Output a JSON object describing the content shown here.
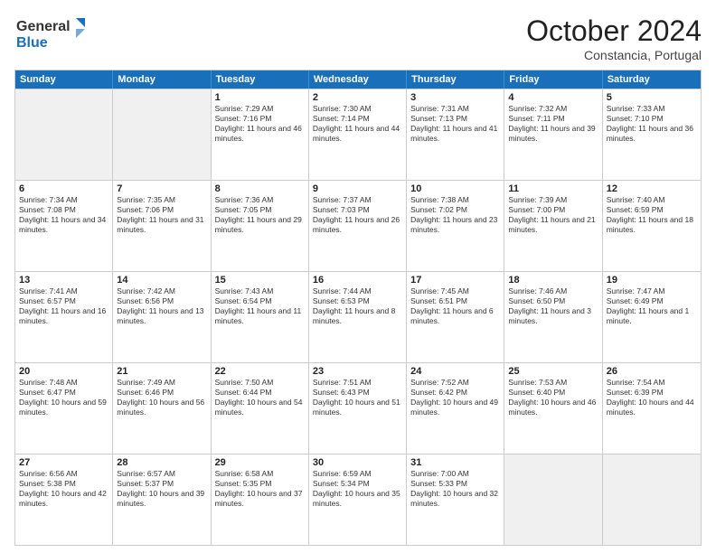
{
  "header": {
    "logo_line1": "General",
    "logo_line2": "Blue",
    "month": "October 2024",
    "location": "Constancia, Portugal"
  },
  "weekdays": [
    "Sunday",
    "Monday",
    "Tuesday",
    "Wednesday",
    "Thursday",
    "Friday",
    "Saturday"
  ],
  "rows": [
    [
      {
        "day": "",
        "lines": []
      },
      {
        "day": "",
        "lines": []
      },
      {
        "day": "1",
        "lines": [
          "Sunrise: 7:29 AM",
          "Sunset: 7:16 PM",
          "Daylight: 11 hours and 46 minutes."
        ]
      },
      {
        "day": "2",
        "lines": [
          "Sunrise: 7:30 AM",
          "Sunset: 7:14 PM",
          "Daylight: 11 hours and 44 minutes."
        ]
      },
      {
        "day": "3",
        "lines": [
          "Sunrise: 7:31 AM",
          "Sunset: 7:13 PM",
          "Daylight: 11 hours and 41 minutes."
        ]
      },
      {
        "day": "4",
        "lines": [
          "Sunrise: 7:32 AM",
          "Sunset: 7:11 PM",
          "Daylight: 11 hours and 39 minutes."
        ]
      },
      {
        "day": "5",
        "lines": [
          "Sunrise: 7:33 AM",
          "Sunset: 7:10 PM",
          "Daylight: 11 hours and 36 minutes."
        ]
      }
    ],
    [
      {
        "day": "6",
        "lines": [
          "Sunrise: 7:34 AM",
          "Sunset: 7:08 PM",
          "Daylight: 11 hours and 34 minutes."
        ]
      },
      {
        "day": "7",
        "lines": [
          "Sunrise: 7:35 AM",
          "Sunset: 7:06 PM",
          "Daylight: 11 hours and 31 minutes."
        ]
      },
      {
        "day": "8",
        "lines": [
          "Sunrise: 7:36 AM",
          "Sunset: 7:05 PM",
          "Daylight: 11 hours and 29 minutes."
        ]
      },
      {
        "day": "9",
        "lines": [
          "Sunrise: 7:37 AM",
          "Sunset: 7:03 PM",
          "Daylight: 11 hours and 26 minutes."
        ]
      },
      {
        "day": "10",
        "lines": [
          "Sunrise: 7:38 AM",
          "Sunset: 7:02 PM",
          "Daylight: 11 hours and 23 minutes."
        ]
      },
      {
        "day": "11",
        "lines": [
          "Sunrise: 7:39 AM",
          "Sunset: 7:00 PM",
          "Daylight: 11 hours and 21 minutes."
        ]
      },
      {
        "day": "12",
        "lines": [
          "Sunrise: 7:40 AM",
          "Sunset: 6:59 PM",
          "Daylight: 11 hours and 18 minutes."
        ]
      }
    ],
    [
      {
        "day": "13",
        "lines": [
          "Sunrise: 7:41 AM",
          "Sunset: 6:57 PM",
          "Daylight: 11 hours and 16 minutes."
        ]
      },
      {
        "day": "14",
        "lines": [
          "Sunrise: 7:42 AM",
          "Sunset: 6:56 PM",
          "Daylight: 11 hours and 13 minutes."
        ]
      },
      {
        "day": "15",
        "lines": [
          "Sunrise: 7:43 AM",
          "Sunset: 6:54 PM",
          "Daylight: 11 hours and 11 minutes."
        ]
      },
      {
        "day": "16",
        "lines": [
          "Sunrise: 7:44 AM",
          "Sunset: 6:53 PM",
          "Daylight: 11 hours and 8 minutes."
        ]
      },
      {
        "day": "17",
        "lines": [
          "Sunrise: 7:45 AM",
          "Sunset: 6:51 PM",
          "Daylight: 11 hours and 6 minutes."
        ]
      },
      {
        "day": "18",
        "lines": [
          "Sunrise: 7:46 AM",
          "Sunset: 6:50 PM",
          "Daylight: 11 hours and 3 minutes."
        ]
      },
      {
        "day": "19",
        "lines": [
          "Sunrise: 7:47 AM",
          "Sunset: 6:49 PM",
          "Daylight: 11 hours and 1 minute."
        ]
      }
    ],
    [
      {
        "day": "20",
        "lines": [
          "Sunrise: 7:48 AM",
          "Sunset: 6:47 PM",
          "Daylight: 10 hours and 59 minutes."
        ]
      },
      {
        "day": "21",
        "lines": [
          "Sunrise: 7:49 AM",
          "Sunset: 6:46 PM",
          "Daylight: 10 hours and 56 minutes."
        ]
      },
      {
        "day": "22",
        "lines": [
          "Sunrise: 7:50 AM",
          "Sunset: 6:44 PM",
          "Daylight: 10 hours and 54 minutes."
        ]
      },
      {
        "day": "23",
        "lines": [
          "Sunrise: 7:51 AM",
          "Sunset: 6:43 PM",
          "Daylight: 10 hours and 51 minutes."
        ]
      },
      {
        "day": "24",
        "lines": [
          "Sunrise: 7:52 AM",
          "Sunset: 6:42 PM",
          "Daylight: 10 hours and 49 minutes."
        ]
      },
      {
        "day": "25",
        "lines": [
          "Sunrise: 7:53 AM",
          "Sunset: 6:40 PM",
          "Daylight: 10 hours and 46 minutes."
        ]
      },
      {
        "day": "26",
        "lines": [
          "Sunrise: 7:54 AM",
          "Sunset: 6:39 PM",
          "Daylight: 10 hours and 44 minutes."
        ]
      }
    ],
    [
      {
        "day": "27",
        "lines": [
          "Sunrise: 6:56 AM",
          "Sunset: 5:38 PM",
          "Daylight: 10 hours and 42 minutes."
        ]
      },
      {
        "day": "28",
        "lines": [
          "Sunrise: 6:57 AM",
          "Sunset: 5:37 PM",
          "Daylight: 10 hours and 39 minutes."
        ]
      },
      {
        "day": "29",
        "lines": [
          "Sunrise: 6:58 AM",
          "Sunset: 5:35 PM",
          "Daylight: 10 hours and 37 minutes."
        ]
      },
      {
        "day": "30",
        "lines": [
          "Sunrise: 6:59 AM",
          "Sunset: 5:34 PM",
          "Daylight: 10 hours and 35 minutes."
        ]
      },
      {
        "day": "31",
        "lines": [
          "Sunrise: 7:00 AM",
          "Sunset: 5:33 PM",
          "Daylight: 10 hours and 32 minutes."
        ]
      },
      {
        "day": "",
        "lines": []
      },
      {
        "day": "",
        "lines": []
      }
    ]
  ]
}
